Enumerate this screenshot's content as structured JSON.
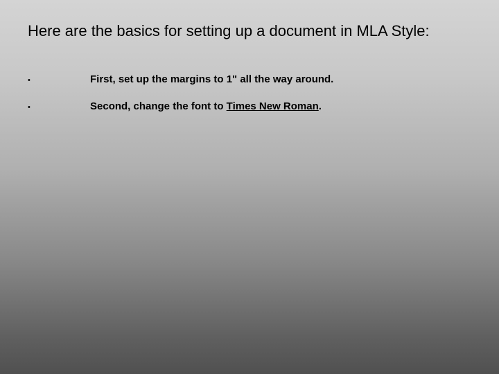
{
  "title": "Here are the basics for setting up a document in MLA Style:",
  "bullets": [
    {
      "marker": "•",
      "text_before": "First, set up the margins to 1\" all the way around.",
      "underlined": "",
      "text_after": ""
    },
    {
      "marker": "•",
      "text_before": "Second, change the font to ",
      "underlined": "Times New Roman",
      "text_after": "."
    }
  ]
}
